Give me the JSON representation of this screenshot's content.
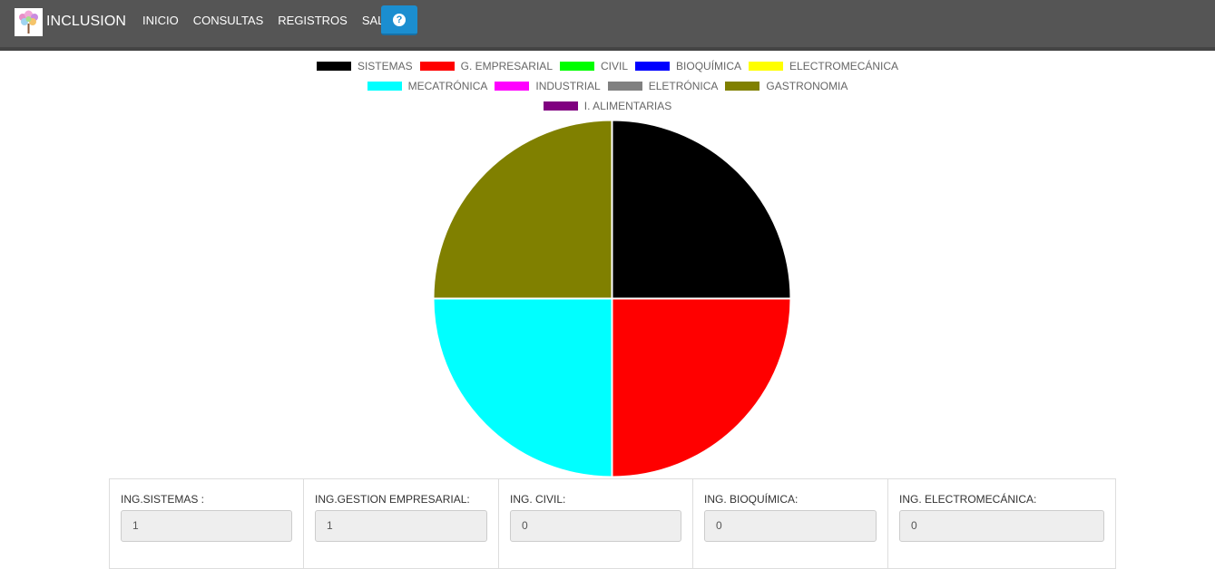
{
  "header": {
    "brand": "INCLUSION",
    "nav": [
      "INICIO",
      "CONSULTAS",
      "REGISTROS",
      "SALIR"
    ],
    "help_icon": "question-circle-icon",
    "colors": {
      "navbar": "#555555",
      "help_button": "#1b8ed0"
    }
  },
  "chart_data": {
    "type": "pie",
    "legend": [
      [
        {
          "label": "SISTEMAS",
          "color": "#000000"
        },
        {
          "label": "G. EMPRESARIAL",
          "color": "#ff0000"
        },
        {
          "label": "CIVIL",
          "color": "#00ff00"
        },
        {
          "label": "BIOQUÍMICA",
          "color": "#0000ff"
        },
        {
          "label": "ELECTROMECÁNICA",
          "color": "#ffff00"
        }
      ],
      [
        {
          "label": "MECATRÓNICA",
          "color": "#00ffff"
        },
        {
          "label": "INDUSTRIAL",
          "color": "#ff00ff"
        },
        {
          "label": "ELETRÓNICA",
          "color": "#808080"
        },
        {
          "label": "GASTRONOMIA",
          "color": "#808000"
        }
      ],
      [
        {
          "label": "I. ALIMENTARIAS",
          "color": "#800080"
        }
      ]
    ],
    "values": [
      1,
      1,
      0,
      0,
      0,
      1,
      0,
      0,
      1,
      0
    ],
    "legend_position": "top"
  },
  "fields": [
    {
      "label": "ING.SISTEMAS :",
      "value": "1"
    },
    {
      "label": "ING.GESTION EMPRESARIAL:",
      "value": "1"
    },
    {
      "label": "ING. CIVIL:",
      "value": "0"
    },
    {
      "label": "ING. BIOQUÍMICA:",
      "value": "0"
    },
    {
      "label": "ING. ELECTROMECÁNICA:",
      "value": "0"
    }
  ]
}
